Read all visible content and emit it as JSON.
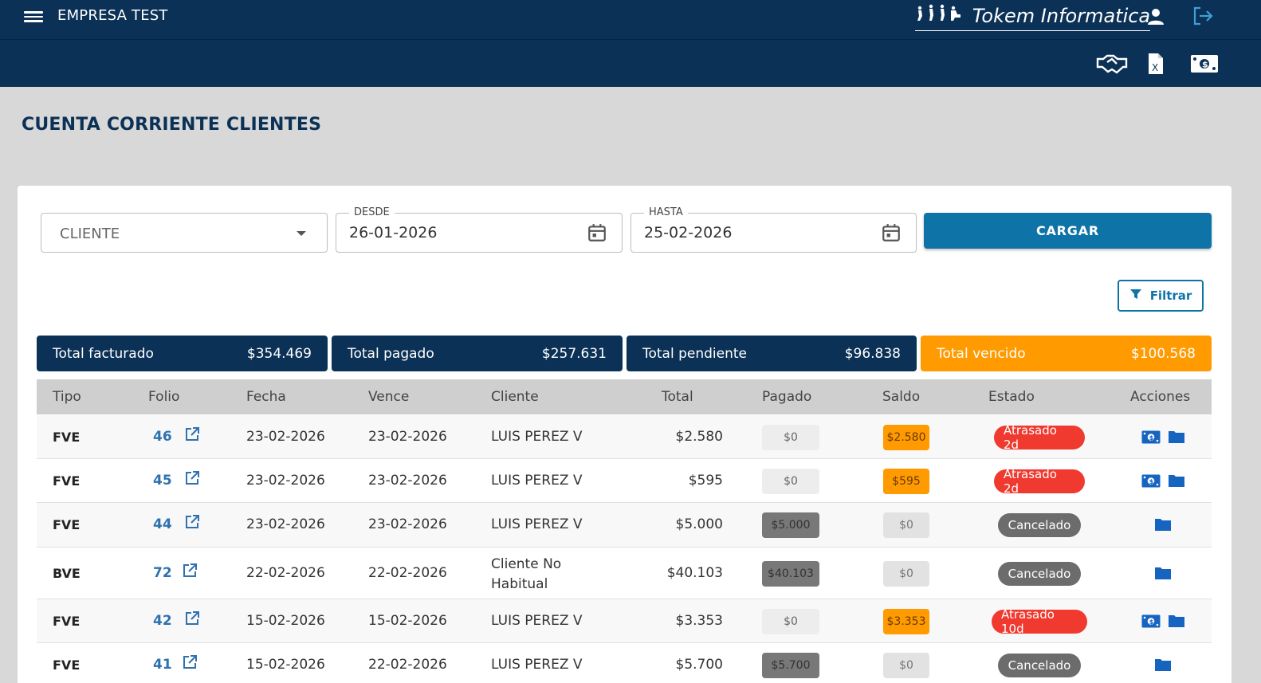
{
  "header": {
    "company": "EMPRESA TEST",
    "brand": "Tokem Informatica",
    "brand_mark": "ƒ¡ƒ¡ƒ¡"
  },
  "page": {
    "title": "CUENTA CORRIENTE CLIENTES"
  },
  "filters": {
    "cliente_placeholder": "CLIENTE",
    "desde_label": "DESDE",
    "desde_value": "26-01-2026",
    "hasta_label": "HASTA",
    "hasta_value": "25-02-2026",
    "cargar_label": "CARGAR",
    "filtrar_label": "Filtrar"
  },
  "totals": [
    {
      "label": "Total facturado",
      "value": "$354.469",
      "color": "#0b3156"
    },
    {
      "label": "Total pagado",
      "value": "$257.631",
      "color": "#0b3156"
    },
    {
      "label": "Total pendiente",
      "value": "$96.838",
      "color": "#0b3156"
    },
    {
      "label": "Total vencido",
      "value": "$100.568",
      "color": "#ff9a00"
    }
  ],
  "table": {
    "columns": [
      "Tipo",
      "Folio",
      "Fecha",
      "Vence",
      "Cliente",
      "Total",
      "Pagado",
      "Saldo",
      "Estado",
      "Acciones"
    ],
    "rows": [
      {
        "tipo": "FVE",
        "folio": "46",
        "fecha": "23-02-2026",
        "vence": "23-02-2026",
        "cliente": "LUIS PEREZ V",
        "total": "$2.580",
        "pagado": "$0",
        "saldo": "$2.580",
        "estado": "Atrasado 2d"
      },
      {
        "tipo": "FVE",
        "folio": "45",
        "fecha": "23-02-2026",
        "vence": "23-02-2026",
        "cliente": "LUIS PEREZ V",
        "total": "$595",
        "pagado": "$0",
        "saldo": "$595",
        "estado": "Atrasado 2d"
      },
      {
        "tipo": "FVE",
        "folio": "44",
        "fecha": "23-02-2026",
        "vence": "23-02-2026",
        "cliente": "LUIS PEREZ V",
        "total": "$5.000",
        "pagado": "$5.000",
        "saldo": "$0",
        "estado": "Cancelado"
      },
      {
        "tipo": "BVE",
        "folio": "72",
        "fecha": "22-02-2026",
        "vence": "22-02-2026",
        "cliente": "Cliente No Habitual",
        "total": "$40.103",
        "pagado": "$40.103",
        "saldo": "$0",
        "estado": "Cancelado"
      },
      {
        "tipo": "FVE",
        "folio": "42",
        "fecha": "15-02-2026",
        "vence": "15-02-2026",
        "cliente": "LUIS PEREZ V",
        "total": "$3.353",
        "pagado": "$0",
        "saldo": "$3.353",
        "estado": "Atrasado 10d"
      },
      {
        "tipo": "FVE",
        "folio": "41",
        "fecha": "15-02-2026",
        "vence": "22-02-2026",
        "cliente": "LUIS PEREZ V",
        "total": "$5.700",
        "pagado": "$5.700",
        "saldo": "$0",
        "estado": "Cancelado"
      }
    ]
  },
  "colors": {
    "navy": "#0b3156",
    "accent": "#0e74a8",
    "overdue": "#ff9a00",
    "status_late": "#f0392f",
    "status_cancelled": "#6c6c6c",
    "link": "#2f72b0"
  }
}
